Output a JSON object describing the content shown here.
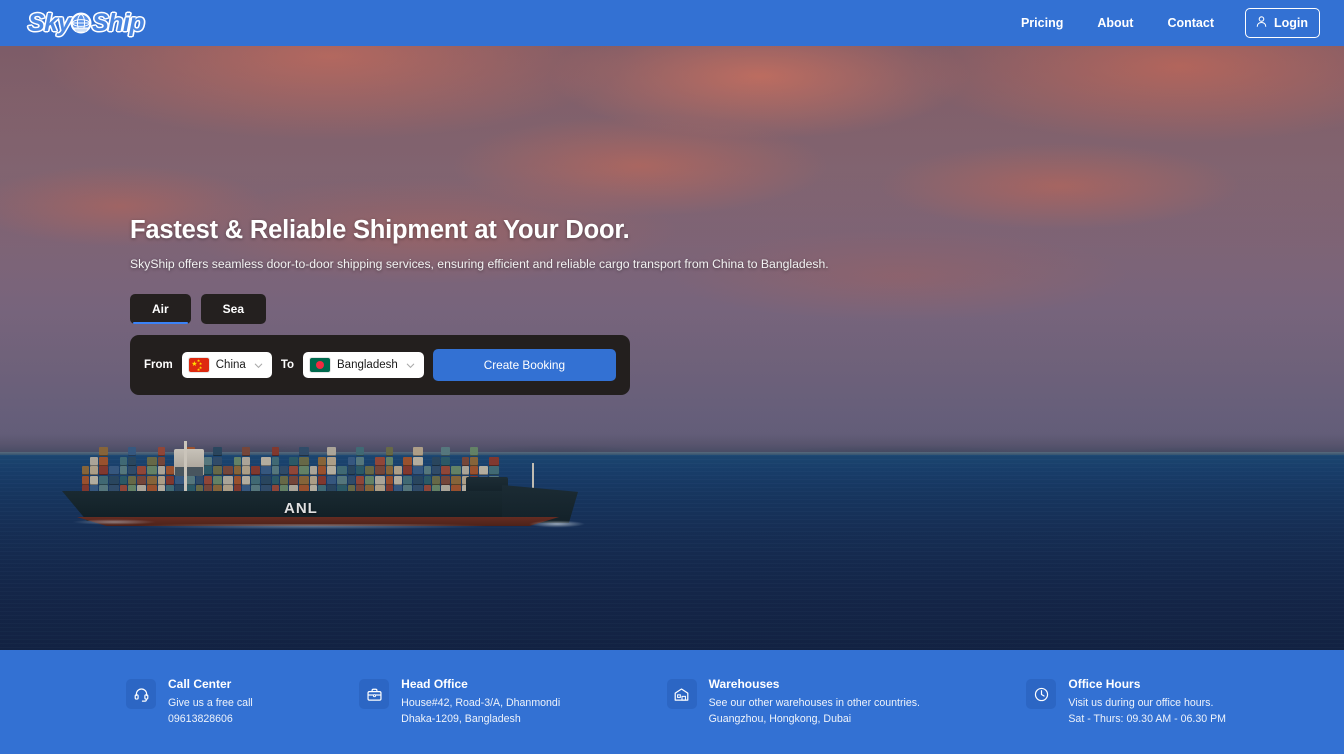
{
  "header": {
    "logo": {
      "text_left": "Sky",
      "text_right": "Ship",
      "icon": "globe-ship-icon"
    },
    "nav": [
      {
        "label": "Pricing",
        "name": "nav-pricing"
      },
      {
        "label": "About",
        "name": "nav-about"
      },
      {
        "label": "Contact",
        "name": "nav-contact"
      }
    ],
    "login": {
      "label": "Login",
      "icon": "user-icon"
    },
    "bg_color": "#3371d3"
  },
  "hero": {
    "title": "Fastest & Reliable Shipment at Your Door.",
    "subtitle": "SkyShip offers seamless door-to-door shipping services, ensuring efficient and reliable cargo transport from China to Bangladesh.",
    "tabs": [
      {
        "label": "Air",
        "active": true
      },
      {
        "label": "Sea",
        "active": false
      }
    ],
    "booking": {
      "from_label": "From",
      "from_value": "China",
      "from_flag": "flag-china-icon",
      "to_label": "To",
      "to_value": "Bangladesh",
      "to_flag": "flag-bangladesh-icon",
      "submit_label": "Create Booking",
      "accent_color": "#3371d3"
    },
    "background": {
      "scene": "container-ship-at-sunset-photo",
      "ship_marking": "ANL",
      "sky_color": "#8a6a76",
      "sea_color": "#17325b"
    }
  },
  "footer": {
    "bg_color": "#3371d3",
    "items": [
      {
        "icon": "headset-icon",
        "title": "Call Center",
        "line1": "Give us a free call",
        "line2": "09613828606"
      },
      {
        "icon": "briefcase-icon",
        "title": "Head Office",
        "line1": "House#42, Road-3/A, Dhanmondi",
        "line2": "Dhaka-1209, Bangladesh"
      },
      {
        "icon": "warehouse-icon",
        "title": "Warehouses",
        "line1": "See our other warehouses in other countries.",
        "line2": "Guangzhou, Hongkong, Dubai"
      },
      {
        "icon": "clock-icon",
        "title": "Office Hours",
        "line1": "Visit us during our office hours.",
        "line2": "Sat - Thurs: 09.30 AM - 06.30 PM"
      }
    ]
  }
}
